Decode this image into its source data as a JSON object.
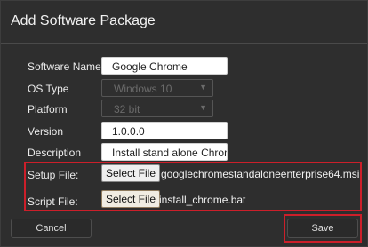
{
  "dialog": {
    "title": "Add Software Package"
  },
  "form": {
    "software_name": {
      "label": "Software Name",
      "value": "Google Chrome"
    },
    "os_type": {
      "label": "OS Type",
      "value": "Windows 10"
    },
    "platform": {
      "label": "Platform",
      "value": "32 bit"
    },
    "version": {
      "label": "Version",
      "value": "1.0.0.0"
    },
    "description": {
      "label": "Description",
      "value": "Install stand alone Chrom"
    }
  },
  "files": {
    "setup": {
      "label": "Setup File:",
      "button": "Select File",
      "filename": "googlechromestandaloneenterprise64.msi"
    },
    "script": {
      "label": "Script File:",
      "button": "Select File",
      "filename": "install_chrome.bat"
    }
  },
  "footer": {
    "cancel_label": "Cancel",
    "save_label": "Save"
  },
  "colors": {
    "highlight": "#cc1f2a",
    "dialog_bg": "#2e2e2e"
  },
  "icons": {
    "select_chevron": "chevron-down-icon"
  }
}
